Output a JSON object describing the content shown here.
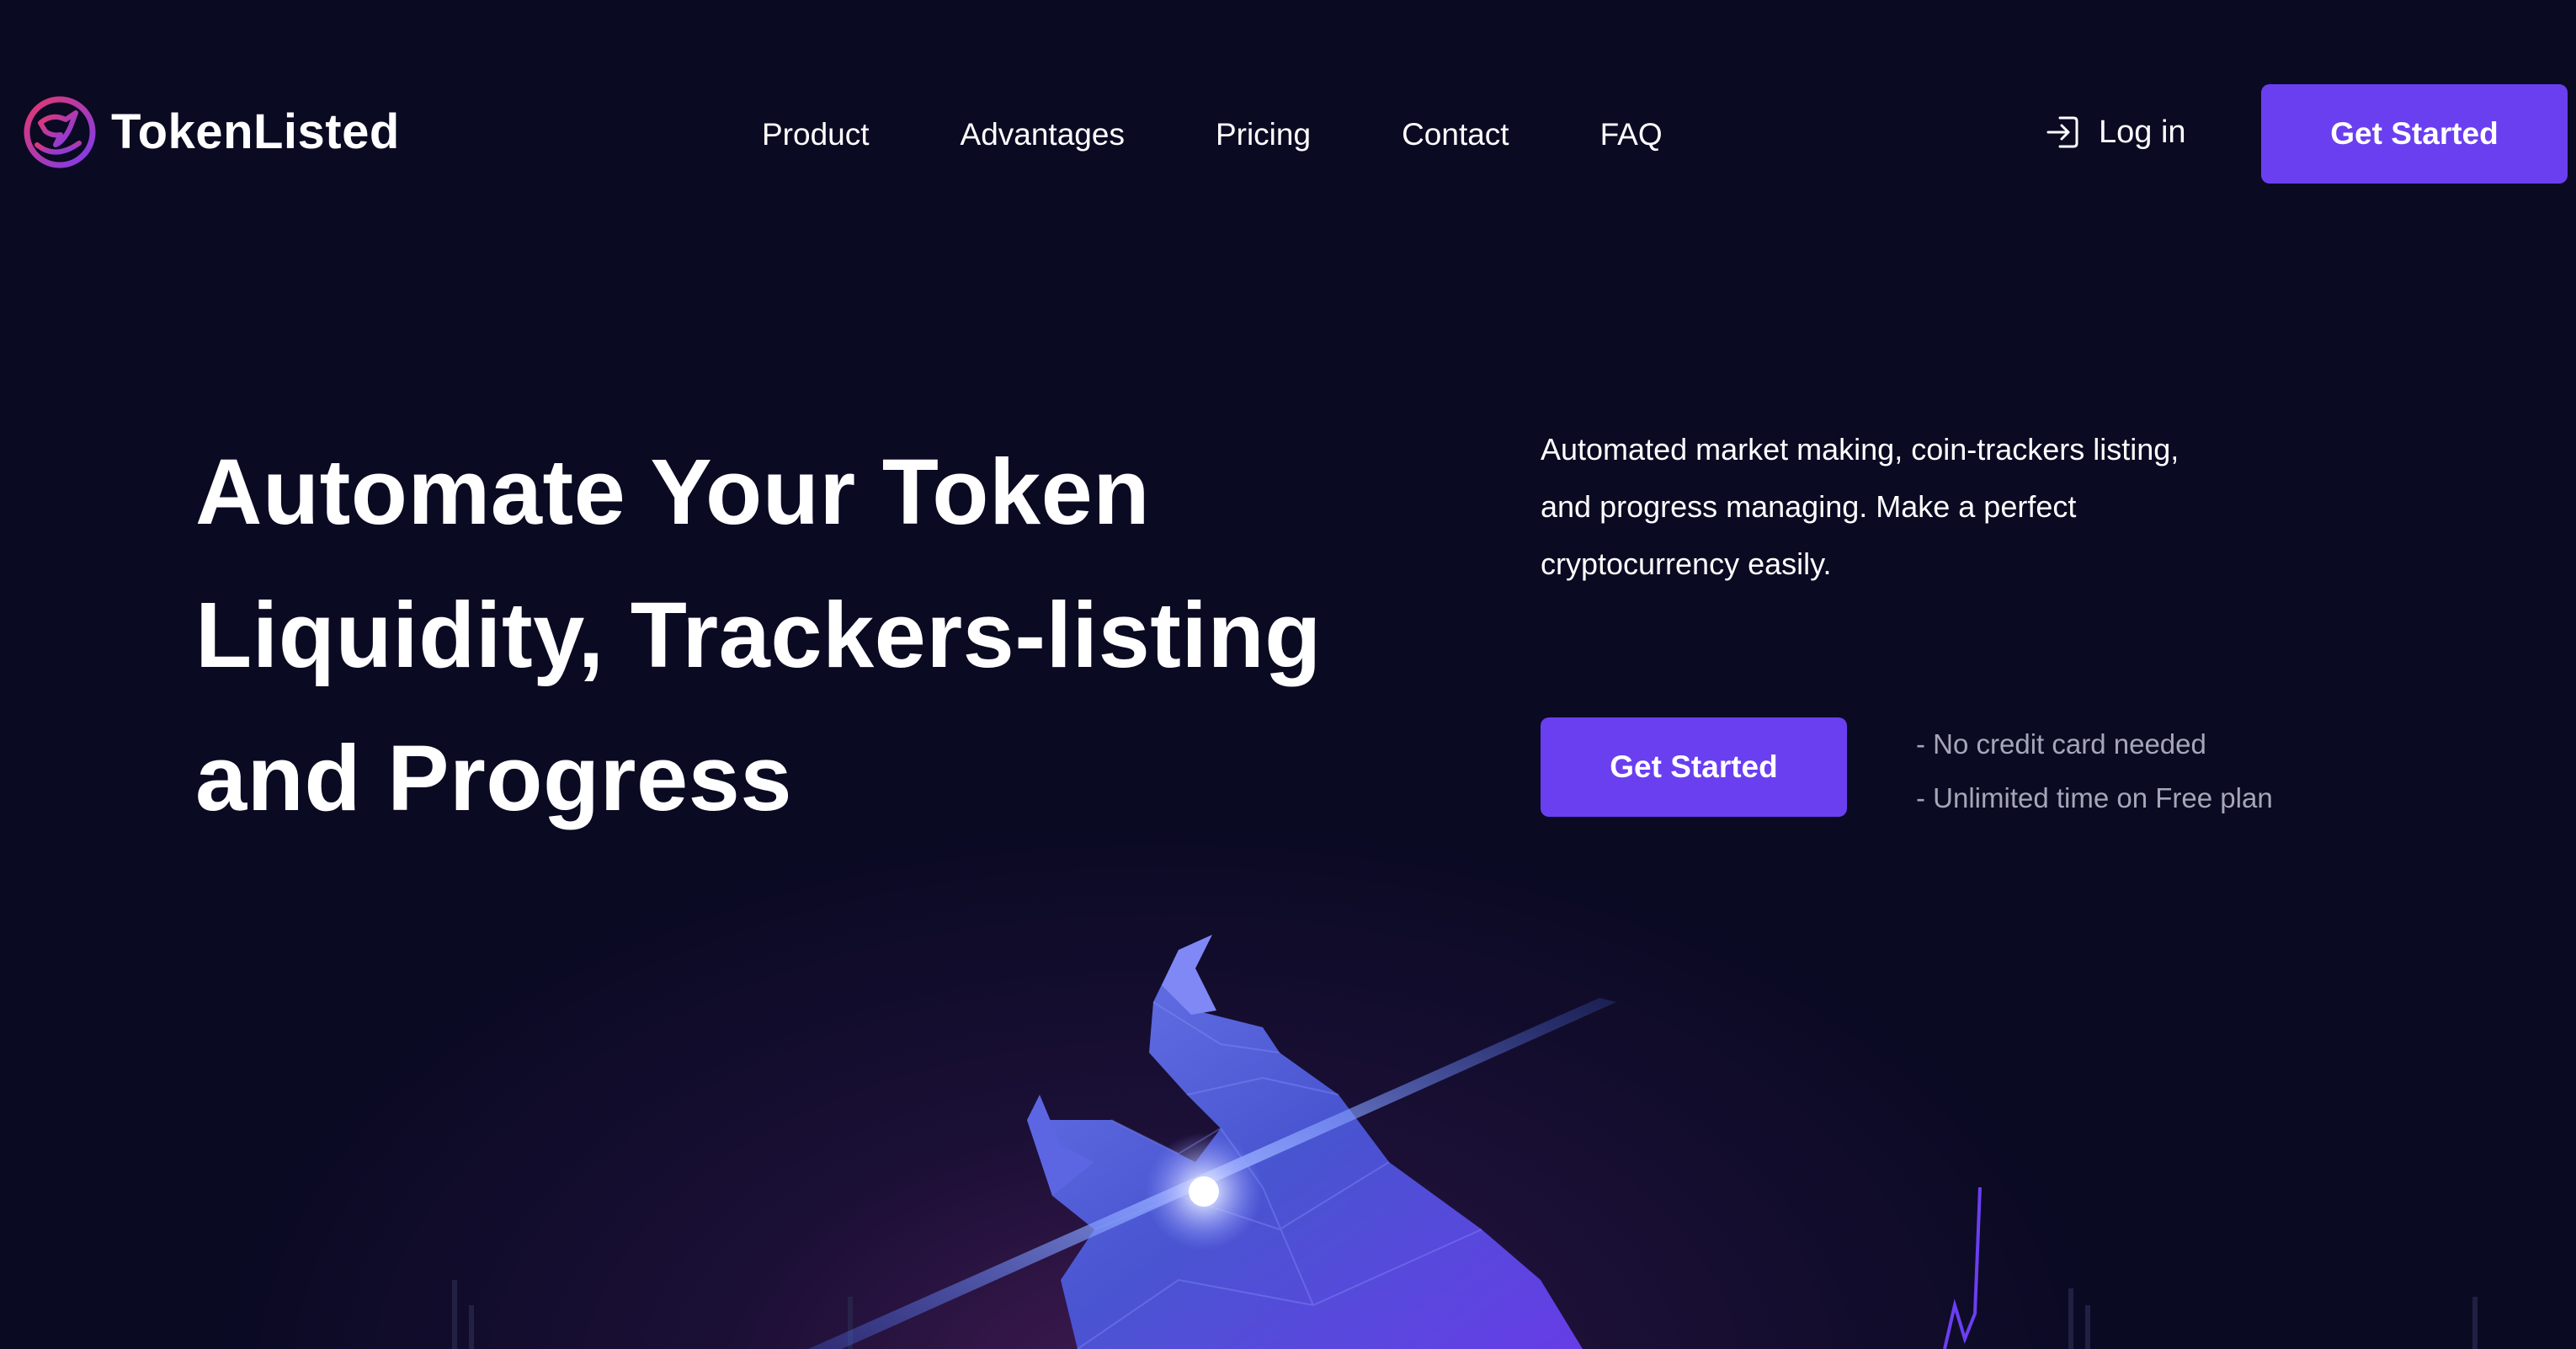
{
  "brand": {
    "name": "TokenListed",
    "logo_icon": "bull-logo-icon",
    "accent_color": "#6a3ff0"
  },
  "nav": {
    "links": [
      "Product",
      "Advantages",
      "Pricing",
      "Contact",
      "FAQ"
    ],
    "login_label": "Log in",
    "login_icon": "login-icon",
    "cta_label": "Get Started"
  },
  "hero": {
    "title_lines": [
      "Automate Your Token",
      "Liquidity, Trackers-listing",
      "and Progress"
    ],
    "description_lines": [
      "Automated market making, coin-trackers listing,",
      "and progress managing. Make a perfect",
      "cryptocurrency easily."
    ],
    "cta_label": "Get Started",
    "notes": [
      "- No credit card needed",
      "- Unlimited time on Free plan"
    ]
  },
  "illustration": {
    "icon": "polygon-bull-illustration"
  }
}
